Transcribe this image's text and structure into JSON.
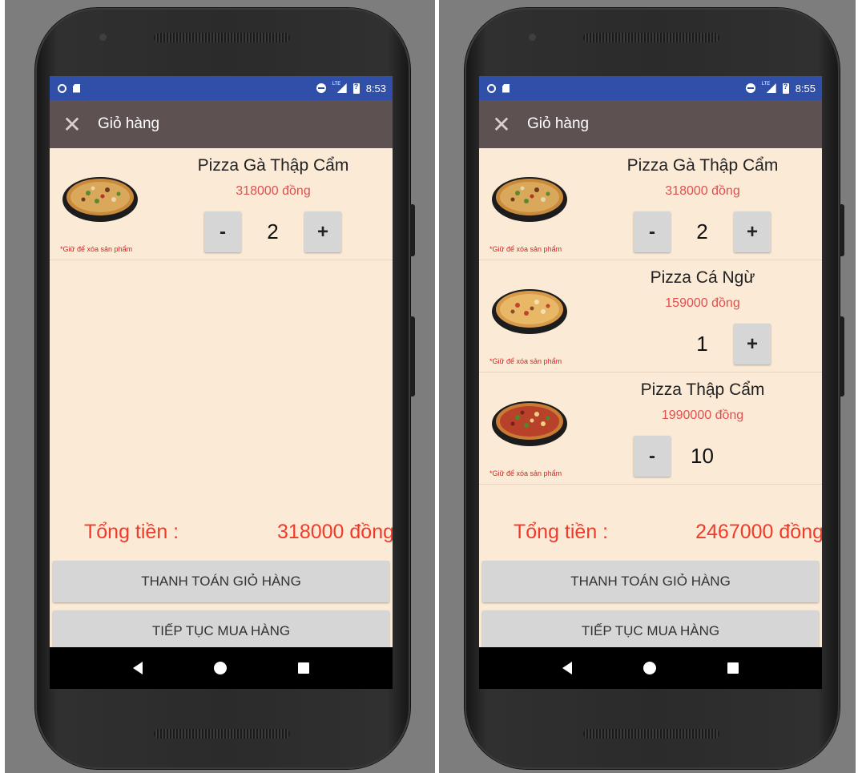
{
  "screens": [
    {
      "status_time": "8:53",
      "toolbar_title": "Giỏ hàng",
      "items": [
        {
          "name": "Pizza Gà Thập Cẩm",
          "price": "318000 đồng",
          "quantity": "2",
          "hint": "*Giữ để xóa sản phẩm",
          "minus_label": "-",
          "plus_label": "+",
          "show_minus": true,
          "show_plus": true,
          "image_icon": "pizza-chicken-image"
        }
      ],
      "total_label": "Tổng tiền :",
      "total_value": "318000 đồng",
      "checkout_label": "THANH TOÁN GIỎ HÀNG",
      "continue_label": "TIẾP TỤC MUA HÀNG"
    },
    {
      "status_time": "8:55",
      "toolbar_title": "Giỏ hàng",
      "items": [
        {
          "name": "Pizza Gà Thập Cẩm",
          "price": "318000 đồng",
          "quantity": "2",
          "hint": "*Giữ để xóa sản phẩm",
          "minus_label": "-",
          "plus_label": "+",
          "show_minus": true,
          "show_plus": true,
          "image_icon": "pizza-chicken-image"
        },
        {
          "name": "Pizza Cá Ngừ",
          "price": "159000 đồng",
          "quantity": "1",
          "hint": "*Giữ để xóa sản phẩm",
          "minus_label": "-",
          "plus_label": "+",
          "show_minus": false,
          "show_plus": true,
          "image_icon": "pizza-tuna-image"
        },
        {
          "name": "Pizza Thập Cẩm",
          "price": "1990000 đồng",
          "quantity": "10",
          "hint": "*Giữ để xóa sản phẩm",
          "minus_label": "-",
          "plus_label": "+",
          "show_minus": true,
          "show_plus": false,
          "image_icon": "pizza-mixed-image"
        }
      ],
      "total_label": "Tổng tiền :",
      "total_value": "2467000 đồng",
      "checkout_label": "THANH TOÁN GIỎ HÀNG",
      "continue_label": "TIẾP TỤC MUA HÀNG"
    }
  ],
  "colors": {
    "status_bar": "#2f4fa8",
    "toolbar": "#5d5151",
    "screen_background": "#fbead6",
    "price_text": "#e0504f",
    "total_text": "#f03a2a",
    "hint_text": "#e02020",
    "button_background": "#d6d6d6"
  },
  "icons": {
    "close": "close-icon",
    "nav_back": "back-triangle-icon",
    "nav_home": "home-circle-icon",
    "nav_recent": "recents-square-icon"
  }
}
